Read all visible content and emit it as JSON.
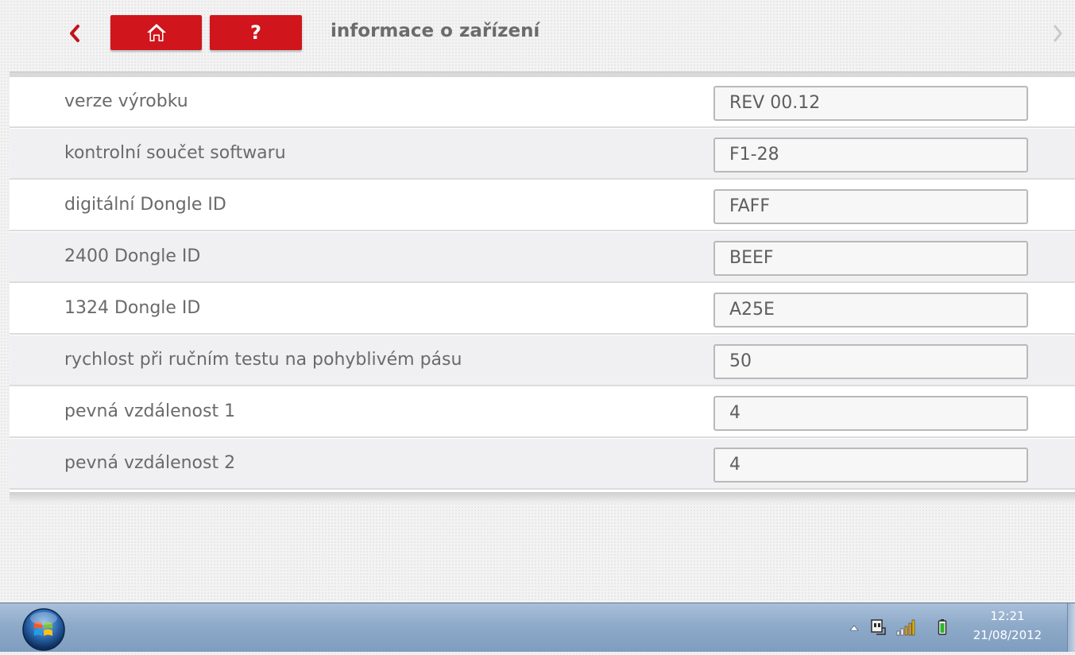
{
  "header": {
    "title": "informace o zařízení",
    "back_icon": "chevron-left-icon",
    "home_icon": "home-icon",
    "help_label": "?",
    "forward_icon": "chevron-right-icon",
    "accent_color": "#d0151d"
  },
  "rows": [
    {
      "label": "verze výrobku",
      "value": "REV 00.12"
    },
    {
      "label": "kontrolní součet softwaru",
      "value": "F1-28"
    },
    {
      "label": "digitální Dongle ID",
      "value": "FAFF"
    },
    {
      "label": "2400 Dongle ID",
      "value": "BEEF"
    },
    {
      "label": "1324 Dongle ID",
      "value": "A25E"
    },
    {
      "label": "rychlost při ručním testu na pohyblivém pásu",
      "value": "50"
    },
    {
      "label": "pevná vzdálenost 1",
      "value": "4"
    },
    {
      "label": "pevná vzdálenost 2",
      "value": "4"
    }
  ],
  "taskbar": {
    "start_icon": "windows-start-icon",
    "tray_icons": [
      "chevron-up-icon",
      "network-plug-icon",
      "signal-bars-icon",
      "battery-icon"
    ],
    "time": "12:21",
    "date": "21/08/2012"
  }
}
